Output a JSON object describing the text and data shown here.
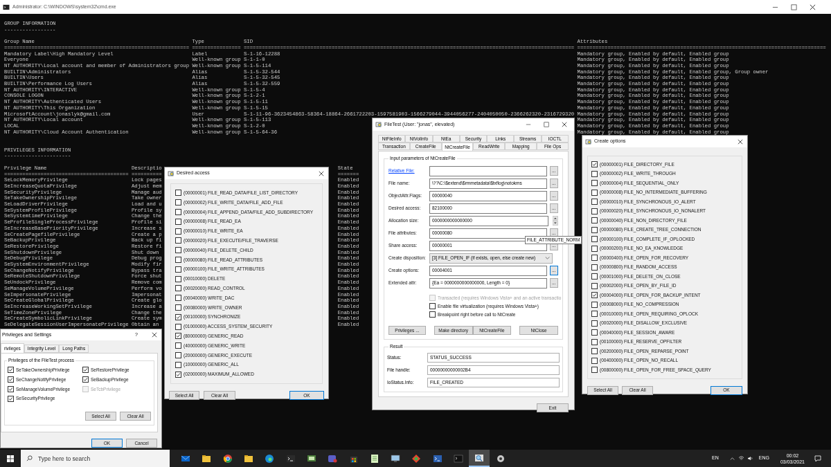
{
  "console": {
    "title": "Administrator: C:\\WINDOWS\\system32\\cmd.exe",
    "group_heading": "GROUP INFORMATION",
    "group_heading_rule": "-----------------",
    "group_columns": [
      "Group Name",
      "Type",
      "SID",
      "Attributes"
    ],
    "group_rules": [
      "=============================================================",
      "================",
      "=============================================================================================================",
      "=================================================================================="
    ],
    "groups": [
      {
        "name": "Mandatory Label\\High Mandatory Level",
        "type": "Label",
        "sid": "S-1-16-12288",
        "attributes": "Mandatory group, Enabled by default, Enabled group"
      },
      {
        "name": "Everyone",
        "type": "Well-known group",
        "sid": "S-1-1-0",
        "attributes": "Mandatory group, Enabled by default, Enabled group"
      },
      {
        "name": "NT AUTHORITY\\Local account and member of Administrators group",
        "type": "Well-known group",
        "sid": "S-1-5-114",
        "attributes": "Mandatory group, Enabled by default, Enabled group"
      },
      {
        "name": "BUILTIN\\Administrators",
        "type": "Alias",
        "sid": "S-1-5-32-544",
        "attributes": "Mandatory group, Enabled by default, Enabled group, Group owner"
      },
      {
        "name": "BUILTIN\\Users",
        "type": "Alias",
        "sid": "S-1-5-32-545",
        "attributes": "Mandatory group, Enabled by default, Enabled group"
      },
      {
        "name": "BUILTIN\\Performance Log Users",
        "type": "Alias",
        "sid": "S-1-5-32-559",
        "attributes": "Mandatory group, Enabled by default, Enabled group"
      },
      {
        "name": "NT AUTHORITY\\INTERACTIVE",
        "type": "Well-known group",
        "sid": "S-1-5-4",
        "attributes": "Mandatory group, Enabled by default, Enabled group"
      },
      {
        "name": "CONSOLE LOGON",
        "type": "Well-known group",
        "sid": "S-1-2-1",
        "attributes": "Mandatory group, Enabled by default, Enabled group"
      },
      {
        "name": "NT AUTHORITY\\Authenticated Users",
        "type": "Well-known group",
        "sid": "S-1-5-11",
        "attributes": "Mandatory group, Enabled by default, Enabled group"
      },
      {
        "name": "NT AUTHORITY\\This Organization",
        "type": "Well-known group",
        "sid": "S-1-5-15",
        "attributes": "Mandatory group, Enabled by default, Enabled group"
      },
      {
        "name": "MicrosoftAccount\\jonaslyk@gmail.com",
        "type": "User",
        "sid": "S-1-11-96-3623454863-58364-18864-2661722203-1597581903-1566279044-3944056277-2404050050-2366262320-2316729320",
        "attributes": "Mandatory group, Enabled by default, Enabled group"
      },
      {
        "name": "NT AUTHORITY\\Local account",
        "type": "Well-known group",
        "sid": "S-1-5-113",
        "attributes": "Mandatory group, Enabled by default, Enabled group"
      },
      {
        "name": "LOCAL",
        "type": "Well-known group",
        "sid": "S-1-2-0",
        "attributes": "Mandatory group, Enabled by default, Enabled group"
      },
      {
        "name": "NT AUTHORITY\\Cloud Account Authentication",
        "type": "Well-known group",
        "sid": "S-1-5-64-36",
        "attributes": "Mandatory group, Enabled by default, Enabled group"
      }
    ],
    "privilege_heading": "PRIVILEGES INFORMATION",
    "privilege_heading_rule": "----------------------",
    "privilege_columns": [
      "Privilege Name",
      "Descriptio",
      "State"
    ],
    "privilege_rules": [
      "=========================================",
      "==========",
      "======="
    ],
    "privileges": [
      {
        "name": "SeLockMemoryPrivilege",
        "description": "Lock pages",
        "state": "Enabled"
      },
      {
        "name": "SeIncreaseQuotaPrivilege",
        "description": "Adjust mem",
        "state": "Enabled"
      },
      {
        "name": "SeSecurityPrivilege",
        "description": "Manage aud",
        "state": "Enabled"
      },
      {
        "name": "SeTakeOwnershipPrivilege",
        "description": "Take owner",
        "state": "Enabled"
      },
      {
        "name": "SeLoadDriverPrivilege",
        "description": "Load and u",
        "state": "Enabled"
      },
      {
        "name": "SeSystemProfilePrivilege",
        "description": "Profile sy",
        "state": "Enabled"
      },
      {
        "name": "SeSystemtimePrivilege",
        "description": "Change the",
        "state": "Enabled"
      },
      {
        "name": "SeProfileSingleProcessPrivilege",
        "description": "Profile si",
        "state": "Enabled"
      },
      {
        "name": "SeIncreaseBasePriorityPrivilege",
        "description": "Increase s",
        "state": "Enabled"
      },
      {
        "name": "SeCreatePagefilePrivilege",
        "description": "Create a p",
        "state": "Enabled"
      },
      {
        "name": "SeBackupPrivilege",
        "description": "Back up fi",
        "state": "Enabled"
      },
      {
        "name": "SeRestorePrivilege",
        "description": "Restore fi",
        "state": "Enabled"
      },
      {
        "name": "SeShutdownPrivilege",
        "description": "Shut down",
        "state": "Enabled"
      },
      {
        "name": "SeDebugPrivilege",
        "description": "Debug prog",
        "state": "Enabled"
      },
      {
        "name": "SeSystemEnvironmentPrivilege",
        "description": "Modify fir",
        "state": "Enabled"
      },
      {
        "name": "SeChangeNotifyPrivilege",
        "description": "Bypass tra",
        "state": "Enabled"
      },
      {
        "name": "SeRemoteShutdownPrivilege",
        "description": "Force shut",
        "state": "Enabled"
      },
      {
        "name": "SeUndockPrivilege",
        "description": "Remove com",
        "state": "Enabled"
      },
      {
        "name": "SeManageVolumePrivilege",
        "description": "Perform vo",
        "state": "Enabled"
      },
      {
        "name": "SeImpersonatePrivilege",
        "description": "Impersonat",
        "state": "Enabled"
      },
      {
        "name": "SeCreateGlobalPrivilege",
        "description": "Create glo",
        "state": "Enabled"
      },
      {
        "name": "SeIncreaseWorkingSetPrivilege",
        "description": "Increase a",
        "state": "Enabled"
      },
      {
        "name": "SeTimeZonePrivilege",
        "description": "Change the",
        "state": "Enabled"
      },
      {
        "name": "SeCreateSymbolicLinkPrivilege",
        "description": "Create sym",
        "state": "Enabled"
      },
      {
        "name": "SeDelegateSessionUserImpersonatePrivilege",
        "description": "Obtain an",
        "state": "Enabled"
      }
    ]
  },
  "desired_access": {
    "title": "Desired access",
    "items": [
      {
        "label": "(00000001) FILE_READ_DATA/FILE_LIST_DIRECTORY",
        "checked": false
      },
      {
        "label": "(00000002) FILE_WRITE_DATA/FILE_ADD_FILE",
        "checked": false
      },
      {
        "label": "(00000004) FILE_APPEND_DATA/FILE_ADD_SUBDIRECTORY",
        "checked": false
      },
      {
        "label": "(00000008) FILE_READ_EA",
        "checked": false
      },
      {
        "label": "(00000010) FILE_WRITE_EA",
        "checked": false
      },
      {
        "label": "(00000020) FILE_EXECUTE/FILE_TRAVERSE",
        "checked": false
      },
      {
        "label": "(00000040) FILE_DELETE_CHILD",
        "checked": false
      },
      {
        "label": "(00000080) FILE_READ_ATTRIBUTES",
        "checked": false
      },
      {
        "label": "(00000100) FILE_WRITE_ATTRIBUTES",
        "checked": false
      },
      {
        "label": "(00010000) DELETE",
        "checked": false
      },
      {
        "label": "(00020000) READ_CONTROL",
        "checked": false
      },
      {
        "label": "(00040000) WRITE_DAC",
        "checked": false
      },
      {
        "label": "(00080000) WRITE_OWNER",
        "checked": false
      },
      {
        "label": "(00100000) SYNCHRONIZE",
        "checked": true
      },
      {
        "label": "(01000000) ACCESS_SYSTEM_SECURITY",
        "checked": false
      },
      {
        "label": "(80000000) GENERIC_READ",
        "checked": true
      },
      {
        "label": "(40000000) GENERIC_WRITE",
        "checked": false
      },
      {
        "label": "(20000000) GENERIC_EXECUTE",
        "checked": false
      },
      {
        "label": "(10000000) GENERIC_ALL",
        "checked": false
      },
      {
        "label": "(02000000) MAXIMUM_ALLOWED",
        "checked": true
      }
    ],
    "buttons": [
      "Select All",
      "Clear All",
      "OK"
    ]
  },
  "filetest": {
    "title": "FileTest (User: \"jonas\", elevated)",
    "tab_rows": [
      [
        {
          "label": "NtFileInfo",
          "selected": false
        },
        {
          "label": "NtVolInfo",
          "selected": false
        },
        {
          "label": "NtEa",
          "selected": false
        },
        {
          "label": "Security",
          "selected": false
        },
        {
          "label": "Links",
          "selected": false
        },
        {
          "label": "Streams",
          "selected": false
        },
        {
          "label": "IOCTL",
          "selected": false
        }
      ],
      [
        {
          "label": "Transaction",
          "selected": false
        },
        {
          "label": "CreateFile",
          "selected": false
        },
        {
          "label": "NtCreateFile",
          "selected": true
        },
        {
          "label": "ReadWrite",
          "selected": false
        },
        {
          "label": "Mapping",
          "selected": false
        },
        {
          "label": "File Ops",
          "selected": false
        }
      ]
    ],
    "input_group": "Input parameters of NtCreateFile",
    "fields": [
      {
        "kind": "browse",
        "label": "Relative File:",
        "link": true,
        "button": "...",
        "focused": false
      },
      {
        "kind": "browse",
        "label": "File name:",
        "link": false,
        "value": "\\??\\C:\\$extend\\$rmmetadata\\$txflog\\notokms",
        "button": "...",
        "focused": false
      },
      {
        "kind": "browse",
        "label": "ObjectAttr.Flags:",
        "link": false,
        "value": "00000040",
        "button": "...",
        "focused": false
      },
      {
        "kind": "browse",
        "label": "Desired access:",
        "link": false,
        "value": "82100000",
        "button": "...",
        "focused": false
      },
      {
        "kind": "spin",
        "label": "Allocation size:",
        "link": false,
        "value": "0000000000000000"
      },
      {
        "kind": "browse",
        "label": "File attributes:",
        "link": false,
        "value": "00000080",
        "button": "...",
        "focused": false
      },
      {
        "kind": "browse",
        "label": "Share access:",
        "link": false,
        "value": "00000001",
        "button": "...",
        "focused": false
      },
      {
        "kind": "dropdown",
        "label": "Create disposition:",
        "link": false,
        "value": "[3] FILE_OPEN_IF (if exists, open, else create new)"
      },
      {
        "kind": "browse",
        "label": "Create options:",
        "link": false,
        "value": "00004001",
        "button": "...",
        "focused": true
      },
      {
        "kind": "browse",
        "label": "Extended attr:",
        "link": false,
        "value": "{Ea = 0000000000000000, Length = 0}",
        "button": "...",
        "focused": false
      }
    ],
    "tooltip": "FILE_ATTRIBUTE_NORM",
    "options": [
      {
        "label": "Transacted (requires Windows Vista+ and an active transactio",
        "checked": false,
        "disabled": true
      },
      {
        "label": "Enable file virtualization (requires Windows Vista+)",
        "checked": false,
        "disabled": false
      },
      {
        "label": "Breakpoint right before call to NtCreate",
        "checked": false,
        "disabled": false
      }
    ],
    "actions": [
      "Privileges ...",
      "Make directory",
      "NtCreateFile",
      "NtClose"
    ],
    "result_group": "Result",
    "results": [
      {
        "label": "Status:",
        "value": "STATUS_SUCCESS"
      },
      {
        "label": "File handle:",
        "value": "00000000000002B4"
      },
      {
        "label": "IoStatus.Info:",
        "value": "FILE_CREATED"
      }
    ],
    "exit": "Exit"
  },
  "create_options": {
    "title": "Create options",
    "items": [
      {
        "label": "(00000001) FILE_DIRECTORY_FILE",
        "checked": true
      },
      {
        "label": "(00000002) FILE_WRITE_THROUGH",
        "checked": false
      },
      {
        "label": "(00000004) FILE_SEQUENTIAL_ONLY",
        "checked": false
      },
      {
        "label": "(00000008) FILE_NO_INTERMEDIATE_BUFFERING",
        "checked": false
      },
      {
        "label": "(00000010) FILE_SYNCHRONOUS_IO_ALERT",
        "checked": false
      },
      {
        "label": "(00000020) FILE_SYNCHRONOUS_IO_NONALERT",
        "checked": false
      },
      {
        "label": "(00000040) FILE_NON_DIRECTORY_FILE",
        "checked": false
      },
      {
        "label": "(00000080) FILE_CREATE_TREE_CONNECTION",
        "checked": false
      },
      {
        "label": "(00000100) FILE_COMPLETE_IF_OPLOCKED",
        "checked": false
      },
      {
        "label": "(00000200) FILE_NO_EA_KNOWLEDGE",
        "checked": false
      },
      {
        "label": "(00000400) FILE_OPEN_FOR_RECOVERY",
        "checked": false
      },
      {
        "label": "(00000800) FILE_RANDOM_ACCESS",
        "checked": false
      },
      {
        "label": "(00001000) FILE_DELETE_ON_CLOSE",
        "checked": false
      },
      {
        "label": "(00002000) FILE_OPEN_BY_FILE_ID",
        "checked": false
      },
      {
        "label": "(00004000) FILE_OPEN_FOR_BACKUP_INTENT",
        "checked": true
      },
      {
        "label": "(00008000) FILE_NO_COMPRESSION",
        "checked": false
      },
      {
        "label": "(00010000) FILE_OPEN_REQUIRING_OPLOCK",
        "checked": false
      },
      {
        "label": "(00020000) FILE_DISALLOW_EXCLUSIVE",
        "checked": false
      },
      {
        "label": "(00040000) FILE_SESSION_AWARE",
        "checked": false
      },
      {
        "label": "(00100000) FILE_RESERVE_OPFILTER",
        "checked": false
      },
      {
        "label": "(00200000) FILE_OPEN_REPARSE_POINT",
        "checked": false
      },
      {
        "label": "(00400000) FILE_OPEN_NO_RECALL",
        "checked": false
      },
      {
        "label": "(00800000) FILE_OPEN_FOR_FREE_SPACE_QUERY",
        "checked": false
      }
    ],
    "buttons": [
      "Select All",
      "Clear All",
      "OK"
    ]
  },
  "privileges_dialog": {
    "title": "Privileges and Settings",
    "help": "?",
    "tabs": [
      {
        "label": "rivileges",
        "selected": true
      },
      {
        "label": "Integrity Level",
        "selected": false
      },
      {
        "label": "Long Paths",
        "selected": false
      }
    ],
    "group": "Privileges of the FileTest process",
    "items": [
      {
        "label": "SeTakeOwnershipPrivilege",
        "checked": true,
        "disabled": false
      },
      {
        "label": "SeRestorePrivilege",
        "checked": true,
        "disabled": false
      },
      {
        "label": "SeChangeNotifyPrivilege",
        "checked": true,
        "disabled": false
      },
      {
        "label": "SeBackupPrivilege",
        "checked": true,
        "disabled": false
      },
      {
        "label": "SeManageVolumePrivilege",
        "checked": true,
        "disabled": false
      },
      {
        "label": "SeTcbPrivilege",
        "checked": false,
        "disabled": true
      },
      {
        "label": "SeSecurityPrivilege",
        "checked": true,
        "disabled": false
      }
    ],
    "group_buttons": [
      "Select All",
      "Clear All"
    ],
    "buttons": [
      "OK",
      "Cancel"
    ]
  },
  "taskbar": {
    "search": {
      "placeholder": "Type here to search"
    },
    "apps": [
      {
        "selected": false
      },
      {
        "selected": false
      },
      {
        "selected": false
      },
      {
        "selected": false
      },
      {
        "selected": false
      },
      {
        "selected": false
      },
      {
        "selected": false
      },
      {
        "selected": false
      },
      {
        "selected": false
      },
      {
        "selected": false
      },
      {
        "selected": false
      },
      {
        "selected": false
      },
      {
        "selected": false
      },
      {
        "selected": false
      },
      {
        "selected": true
      },
      {
        "selected": false
      }
    ],
    "input_language": "EN",
    "keyboard": "ENG",
    "time": "00:02",
    "date": "03/03/2021"
  }
}
